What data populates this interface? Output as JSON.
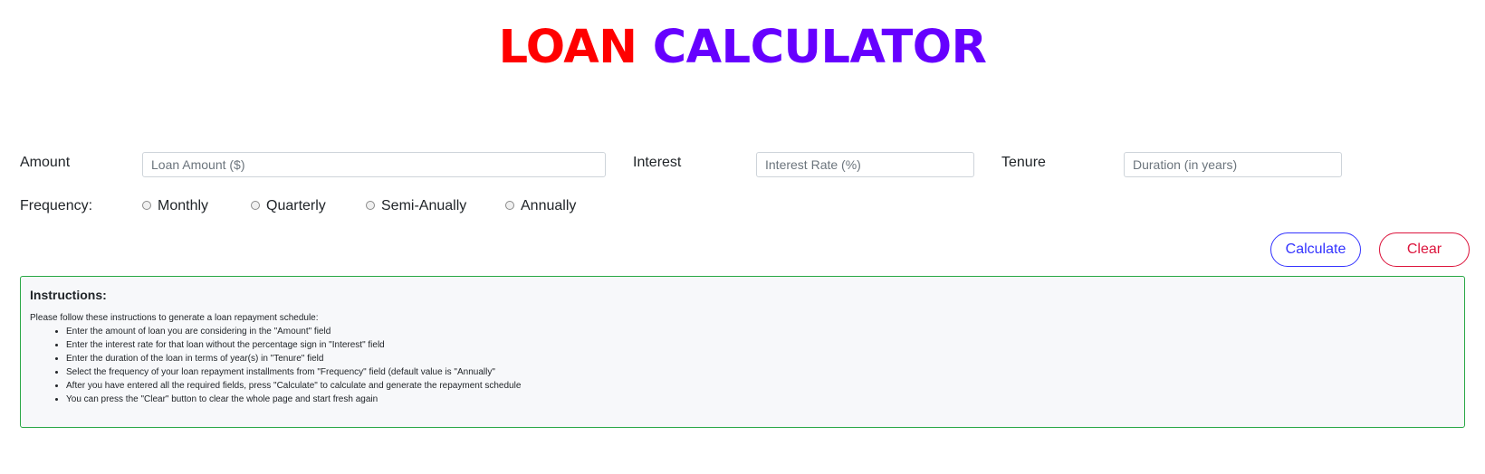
{
  "title": {
    "word1": "LOAN",
    "word2": "CALCULATOR",
    "word1_color": "#ff0000",
    "word2_color": "#6600ff"
  },
  "form": {
    "amount": {
      "label": "Amount",
      "value": "",
      "placeholder": "Loan Amount ($)"
    },
    "interest": {
      "label": "Interest",
      "value": "",
      "placeholder": "Interest Rate (%)"
    },
    "tenure": {
      "label": "Tenure",
      "value": "",
      "placeholder": "Duration (in years)"
    },
    "frequency": {
      "label": "Frequency:",
      "options": [
        "Monthly",
        "Quarterly",
        "Semi-Anually",
        "Annually"
      ],
      "selected": null
    }
  },
  "buttons": {
    "calculate": "Calculate",
    "clear": "Clear",
    "calculate_color": "#3333ff",
    "clear_color": "#dc143c"
  },
  "instructions": {
    "heading": "Instructions:",
    "intro": "Please follow these instructions to generate a loan repayment schedule:",
    "items": [
      "Enter the amount of loan you are considering in the \"Amount\" field",
      "Enter the interest rate for that loan without the percentage sign in \"Interest\" field",
      "Enter the duration of the loan in terms of year(s) in \"Tenure\" field",
      "Select the frequency of your loan repayment installments from \"Frequency\" field (default value is \"Annually\"",
      "After you have entered all the required fields, press \"Calculate\" to calculate and generate the repayment schedule",
      "You can press the \"Clear\" button to clear the whole page and start fresh again"
    ],
    "border_color": "#28a745"
  }
}
